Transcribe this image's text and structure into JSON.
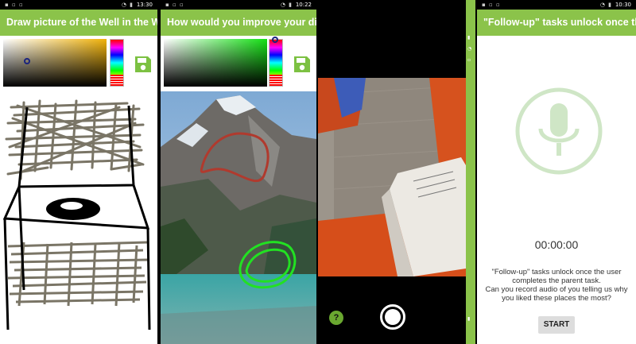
{
  "screens": [
    {
      "time": "13:30",
      "title": "Draw picture of the Well in the Wel...",
      "save_icon": "save-icon",
      "selected_color": "#f1b30b"
    },
    {
      "time": "10:22",
      "title": "How would you improve your disli...",
      "save_icon": "save-icon",
      "selected_color": "#15e115"
    },
    {
      "help_label": "?",
      "capture_icon": "shutter-icon"
    },
    {
      "time": "10:30",
      "title": "\"Follow-up\" tasks unlock once the...",
      "timer": "00:00:00",
      "description_lines": [
        "\"Follow-up\" tasks unlock once the user",
        "completes the parent task.",
        "Can you record audio of you telling us why",
        "you liked these places the most?"
      ],
      "start_label": "START",
      "mic_icon": "microphone-icon"
    }
  ],
  "colors": {
    "accent": "#8bc34a",
    "save": "#7cc142"
  }
}
